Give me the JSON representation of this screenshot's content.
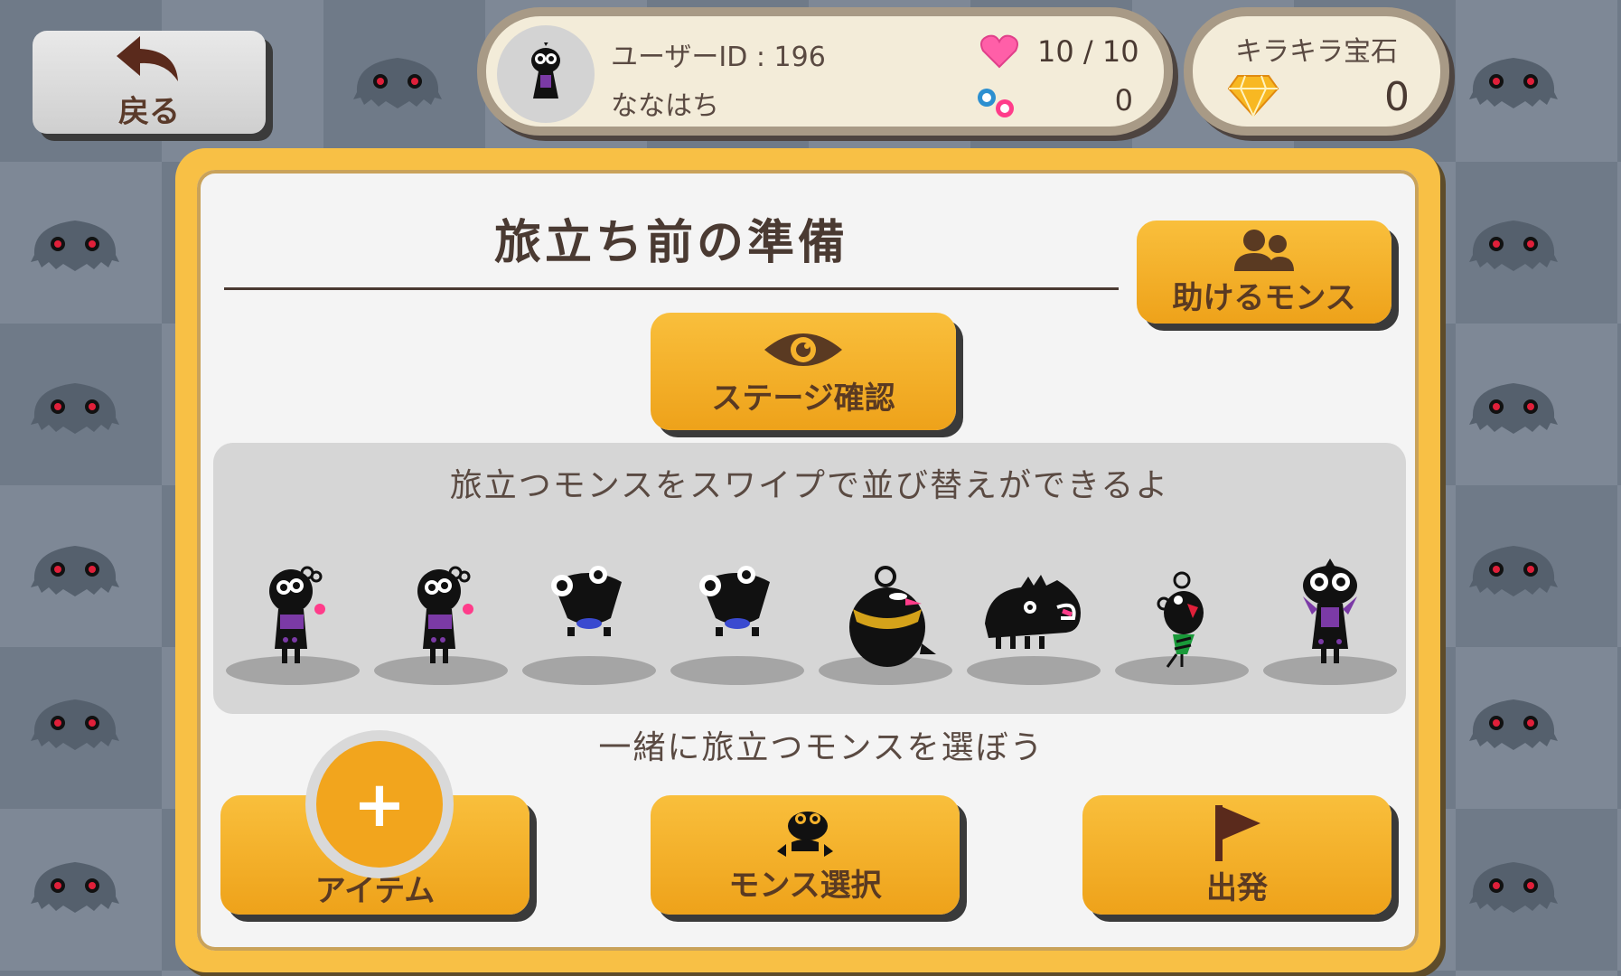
{
  "nav": {
    "back_label": "戻る"
  },
  "user": {
    "id_label": "ユーザーID : 196",
    "name": "ななはち",
    "stamina": "10 / 10",
    "orbs": "0"
  },
  "gems": {
    "title": "キラキラ宝石",
    "value": "0"
  },
  "dialog": {
    "title": "旅立ち前の準備",
    "help_label": "助けるモンス",
    "stage_label": "ステージ確認",
    "party_hint": "旅立つモンスをスワイプで並び替えができるよ",
    "choose_hint": "一緒に旅立つモンスを選ぼう",
    "item_label": "アイテム",
    "plus_symbol": "+",
    "mons_select_label": "モンス選択",
    "depart_label": "出発"
  },
  "party": [
    {
      "icon": "purple-horned-monster-icon"
    },
    {
      "icon": "purple-horned-monster-icon"
    },
    {
      "icon": "frog-monster-icon"
    },
    {
      "icon": "frog-monster-icon"
    },
    {
      "icon": "round-bird-monster-icon"
    },
    {
      "icon": "spiky-beast-monster-icon"
    },
    {
      "icon": "small-sprout-monster-icon"
    },
    {
      "icon": "bird-mask-monster-icon"
    }
  ],
  "colors": {
    "button_orange": "#f5b22c",
    "dialog_border": "#f8c045",
    "heart": "#ff5fa8",
    "gem": "#f8b822"
  }
}
